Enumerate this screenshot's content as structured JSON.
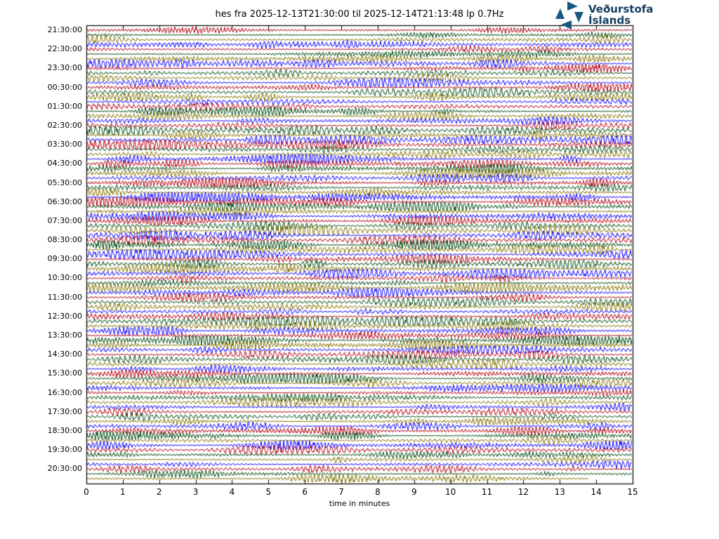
{
  "header": {
    "logo": {
      "line1": "Veðurstofa",
      "line2": "Íslands",
      "icon": "pinwheel-icon",
      "icon_color": "#16597f",
      "text_color": "#153e61"
    }
  },
  "chart_data": {
    "type": "line",
    "subtype": "helicorder dayplot (seismic drum plot, continuous waveform rows)",
    "station": "hes",
    "title": "hes fra 2025-12-13T21:30:00 til 2025-12-14T21:13:48 lp 0.7Hz",
    "xlabel": "time in minutes",
    "xlim": [
      0,
      15
    ],
    "xtick_labels": [
      "0",
      "1",
      "2",
      "3",
      "4",
      "5",
      "6",
      "7",
      "8",
      "9",
      "10",
      "11",
      "12",
      "13",
      "14",
      "15"
    ],
    "row_labels": [
      "21:30:00",
      "22:30:00",
      "23:30:00",
      "00:30:00",
      "01:30:00",
      "02:30:00",
      "03:30:00",
      "04:30:00",
      "05:30:00",
      "06:30:00",
      "07:30:00",
      "08:30:00",
      "09:30:00",
      "10:30:00",
      "11:30:00",
      "12:30:00",
      "13:30:00",
      "14:30:00",
      "15:30:00",
      "16:30:00",
      "17:30:00",
      "18:30:00",
      "19:30:00",
      "20:30:00"
    ],
    "rows_per_label": 4,
    "minutes_per_row": 15,
    "n_rows": 95,
    "first_row_start": "2025-12-13T21:30:00",
    "last_row_end": "2025-12-14T21:13:48",
    "last_row_fraction": 0.92,
    "trace_colors": [
      "#B2000F",
      "#004C12",
      "#847200",
      "#0E01FF"
    ],
    "frame_color": "#000000",
    "grid": false,
    "legend": false,
    "series_note": "Continuous background seismic noise with intermittent tremor bursts on every 15-minute row; waveform sample values are not individually resolvable from the raster and are rendered procedurally."
  }
}
